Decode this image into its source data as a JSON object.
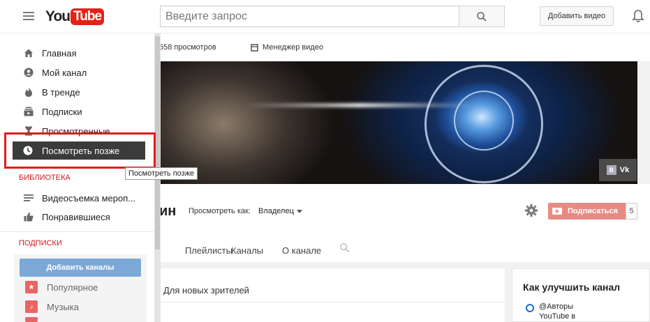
{
  "header": {
    "logo_you": "You",
    "logo_tube": "Tube",
    "search_placeholder": "Введите запрос",
    "upload_label": "Добавить видео"
  },
  "channel": {
    "views": "658 просмотров",
    "video_manager": "Менеджер видео",
    "name_fragment": "ин",
    "view_as_label": "Просмотреть как:",
    "view_as_value": "Владелец",
    "subscribe_label": "Подписаться",
    "subscriber_count": "5",
    "vk_label": "Vk",
    "vk_icon_letter": "B",
    "tabs": [
      {
        "label": "Плейлисты"
      },
      {
        "label": "Каналы"
      },
      {
        "label": "О канале"
      }
    ],
    "new_viewers": "Для новых зрителей",
    "improve": {
      "title": "Как улучшить канал",
      "item": "@Авторы YouTube в"
    }
  },
  "sidebar": {
    "items": [
      {
        "label": "Главная",
        "icon": "home-icon"
      },
      {
        "label": "Мой канал",
        "icon": "account-icon"
      },
      {
        "label": "В тренде",
        "icon": "flame-icon"
      },
      {
        "label": "Подписки",
        "icon": "subscriptions-icon"
      },
      {
        "label": "Просмотренные",
        "icon": "hourglass-icon"
      },
      {
        "label": "Посмотреть позже",
        "icon": "clock-icon",
        "active": true
      }
    ],
    "library_title": "БИБЛИОТЕКА",
    "library_items": [
      {
        "label": "Видеосъемка мероп...",
        "icon": "playlist-icon"
      },
      {
        "label": "Понравившиеся",
        "icon": "thumbs-up-icon"
      }
    ],
    "subscriptions_title": "ПОДПИСКИ",
    "add_channels_label": "Добавить каналы",
    "subscription_items": [
      {
        "label": "Популярное",
        "icon": "star-icon"
      },
      {
        "label": "Музыка",
        "icon": "music-note-icon"
      }
    ]
  },
  "tooltip": "Посмотреть позже",
  "colors": {
    "brand_red": "#e62117",
    "section_red": "#cc181e",
    "highlight_box": "#e21b1b",
    "active_item_bg": "#3b3b3b",
    "add_channels_blue": "#7ca8d8",
    "subscribe_bg": "#e88a84"
  }
}
